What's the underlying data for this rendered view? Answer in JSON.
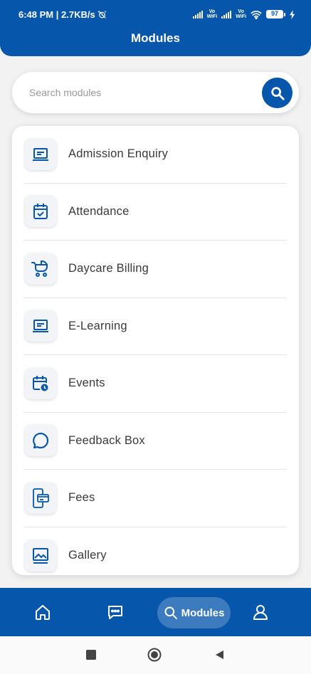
{
  "status_bar": {
    "time_speed": "6:48 PM | 2.7KB/s",
    "volte1": "Vo\nWiFi",
    "volte2": "Vo\nWiFi",
    "battery": "97"
  },
  "header": {
    "title": "Modules"
  },
  "search": {
    "placeholder": "Search modules",
    "value": ""
  },
  "modules": [
    {
      "label": "Admission Enquiry",
      "icon": "laptop-icon"
    },
    {
      "label": "Attendance",
      "icon": "calendar-check-icon"
    },
    {
      "label": "Daycare Billing",
      "icon": "stroller-icon"
    },
    {
      "label": "E-Learning",
      "icon": "laptop-icon"
    },
    {
      "label": "Events",
      "icon": "calendar-clock-icon"
    },
    {
      "label": "Feedback Box",
      "icon": "chat-bubble-icon"
    },
    {
      "label": "Fees",
      "icon": "payment-card-icon"
    },
    {
      "label": "Gallery",
      "icon": "image-icon"
    }
  ],
  "bottom_nav": {
    "items": [
      "home-icon",
      "chat-icon",
      "search-icon",
      "profile-icon"
    ],
    "active_label": "Modules"
  },
  "colors": {
    "primary": "#0656ab",
    "background": "#f2f2f2",
    "card": "#ffffff"
  }
}
